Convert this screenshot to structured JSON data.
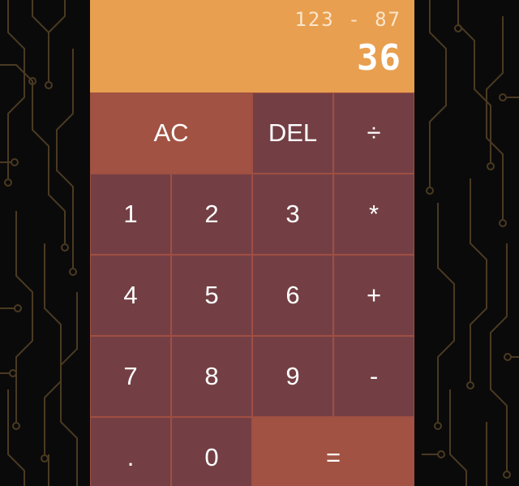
{
  "display": {
    "previous": "123 - 87",
    "current": "36"
  },
  "keys": {
    "ac": "AC",
    "del": "DEL",
    "divide": "÷",
    "one": "1",
    "two": "2",
    "three": "3",
    "multiply": "*",
    "four": "4",
    "five": "5",
    "six": "6",
    "plus": "+",
    "seven": "7",
    "eight": "8",
    "nine": "9",
    "minus": "-",
    "decimal": ".",
    "zero": "0",
    "equals": "="
  },
  "colors": {
    "display_bg": "#e89f4f",
    "key_bg": "#733f44",
    "accent_key_bg": "#a15243",
    "key_border": "#a04f42",
    "page_bg": "#0b0a0a",
    "circuit_lines": "#4a3a22"
  }
}
